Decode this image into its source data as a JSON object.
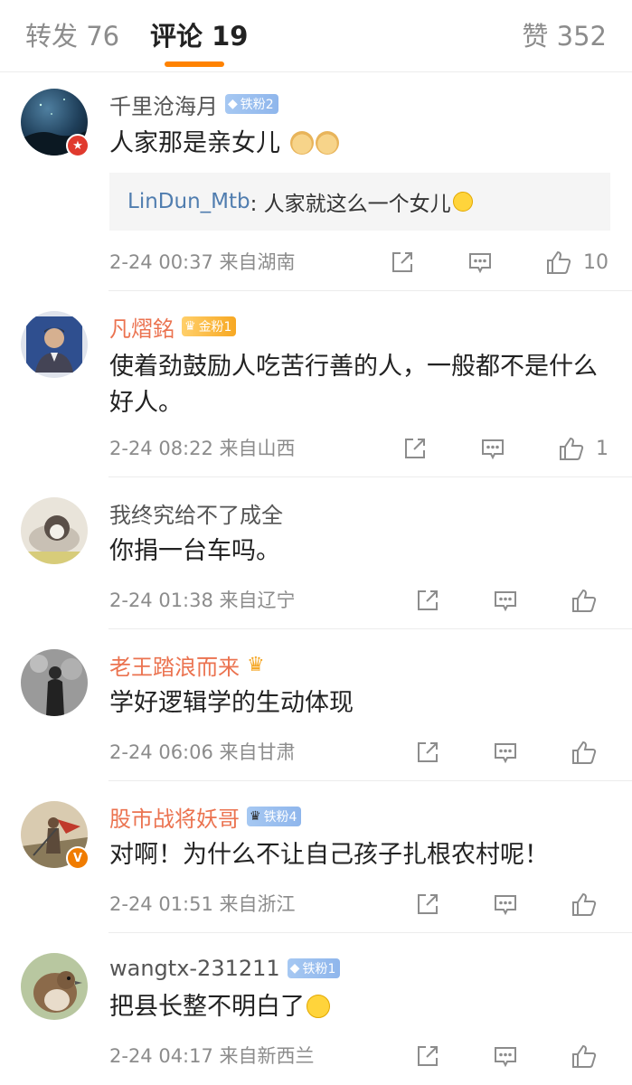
{
  "tabs": {
    "repost": "转发 76",
    "comments": "评论 19",
    "likes": "赞 352"
  },
  "comments": [
    {
      "username": "千里沧海月",
      "fan_badge": "铁粉2",
      "text": "人家那是亲女儿",
      "reply": {
        "name": "LinDun_Mtb",
        "text": ": 人家就这么一个女儿"
      },
      "time": "2-24 00:37",
      "location": "来自湖南",
      "likes": "10"
    },
    {
      "username": "凡熠銘",
      "fan_badge": "金粉1",
      "text": "使着劲鼓励人吃苦行善的人，一般都不是什么好人。",
      "time": "2-24 08:22",
      "location": "来自山西",
      "likes": "1"
    },
    {
      "username": "我终究给不了成全",
      "text": "你捐一台车吗。",
      "time": "2-24 01:38",
      "location": "来自辽宁",
      "likes": ""
    },
    {
      "username": "老王踏浪而来",
      "text": "学好逻辑学的生动体现",
      "time": "2-24 06:06",
      "location": "来自甘肃",
      "likes": ""
    },
    {
      "username": "股市战将妖哥",
      "fan_badge": "铁粉4",
      "text": "对啊！为什么不让自己孩子扎根农村呢！",
      "time": "2-24 01:51",
      "location": "来自浙江",
      "likes": ""
    },
    {
      "username": "wangtx-231211",
      "fan_badge": "铁粉1",
      "text": "把县长整不明白了",
      "time": "2-24 04:17",
      "location": "来自新西兰",
      "likes": ""
    }
  ],
  "colors": {
    "accent": "#ff8200",
    "username_vip": "#eb7350",
    "reply_name": "#507daf"
  },
  "icons": [
    "share-icon",
    "reply-comment-icon",
    "thumbs-up-icon",
    "crown-icon",
    "diamond-icon",
    "verified-badge-icon"
  ]
}
